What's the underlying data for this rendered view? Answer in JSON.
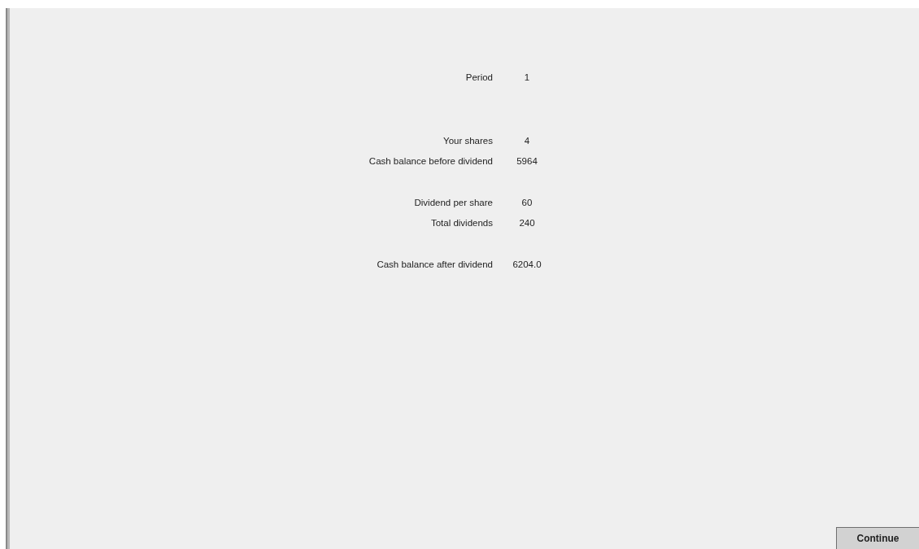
{
  "groups": [
    {
      "rows": [
        {
          "label": "Period",
          "value": "1"
        }
      ]
    },
    {
      "rows": [
        {
          "label": "Your shares",
          "value": "4"
        },
        {
          "label": "Cash balance before dividend",
          "value": "5964"
        }
      ]
    },
    {
      "rows": [
        {
          "label": "Dividend per share",
          "value": "60"
        },
        {
          "label": "Total dividends",
          "value": "240"
        }
      ]
    },
    {
      "rows": [
        {
          "label": "Cash balance after dividend",
          "value": "6204.0"
        }
      ]
    }
  ],
  "button": "Continue"
}
